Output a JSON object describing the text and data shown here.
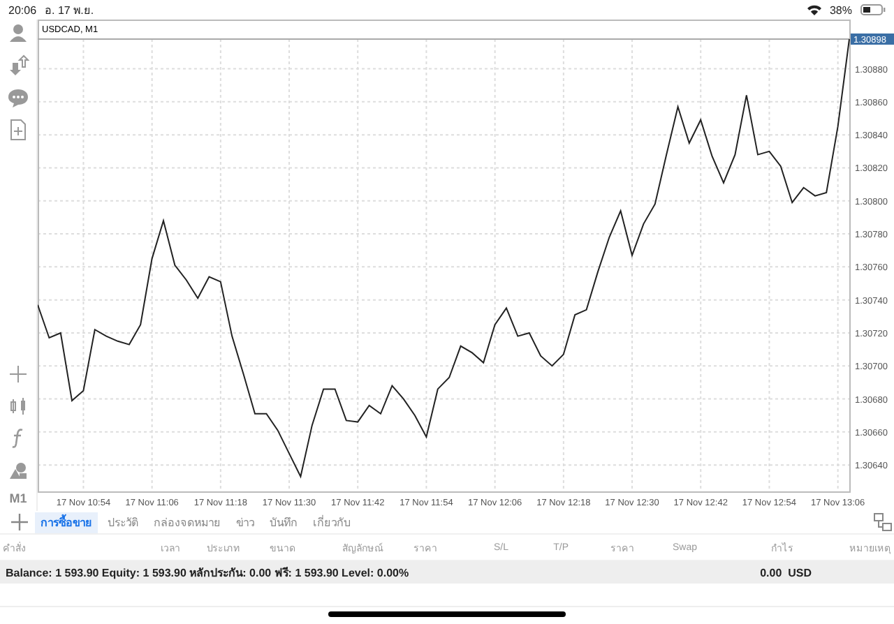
{
  "status_bar": {
    "time": "20:06",
    "date": "อ. 17 พ.ย.",
    "battery": "38%"
  },
  "toolbar": {
    "timeframe": "M1"
  },
  "chart": {
    "title": "USDCAD, M1",
    "current_price": "1.30898",
    "chart_data": {
      "type": "line",
      "grid": true,
      "ylim": [
        1.30624,
        1.30898
      ],
      "categories": [
        null,
        null,
        null,
        null,
        "17 Nov 10:54",
        null,
        null,
        null,
        null,
        null,
        "17 Nov 11:06",
        null,
        null,
        null,
        null,
        null,
        "17 Nov 11:18",
        null,
        null,
        null,
        null,
        null,
        "17 Nov 11:30",
        null,
        null,
        null,
        null,
        null,
        "17 Nov 11:42",
        null,
        null,
        null,
        null,
        null,
        "17 Nov 11:54",
        null,
        null,
        null,
        null,
        null,
        "17 Nov 12:06",
        null,
        null,
        null,
        null,
        null,
        "17 Nov 12:18",
        null,
        null,
        null,
        null,
        null,
        "17 Nov 12:30",
        null,
        null,
        null,
        null,
        null,
        "17 Nov 12:42",
        null,
        null,
        null,
        null,
        null,
        "17 Nov 12:54",
        null,
        null,
        null,
        null,
        null,
        "17 Nov 13:06",
        null
      ],
      "values": [
        1.30737,
        1.30717,
        1.3072,
        1.30679,
        1.30685,
        1.30722,
        1.30718,
        1.30715,
        1.30713,
        1.30725,
        1.30765,
        1.30788,
        1.30761,
        1.30752,
        1.30741,
        1.30754,
        1.30751,
        1.30718,
        1.30695,
        1.30671,
        1.30671,
        1.30661,
        1.30647,
        1.30633,
        1.30664,
        1.30686,
        1.30686,
        1.30667,
        1.30666,
        1.30676,
        1.30671,
        1.30688,
        1.3068,
        1.3067,
        1.30657,
        1.30686,
        1.30693,
        1.30712,
        1.30708,
        1.30702,
        1.30725,
        1.30735,
        1.30718,
        1.3072,
        1.30706,
        1.307,
        1.30707,
        1.30731,
        1.30734,
        1.30757,
        1.30778,
        1.30794,
        1.30767,
        1.30786,
        1.30798,
        1.30828,
        1.30857,
        1.30835,
        1.30849,
        1.30827,
        1.30811,
        1.30828,
        1.30864,
        1.30828,
        1.3083,
        1.30821,
        1.30799,
        1.30808,
        1.30803,
        1.30805,
        1.30845,
        1.30898
      ],
      "yticks": [
        {
          "value": 1.3064,
          "label": "1.30640"
        },
        {
          "value": 1.3066,
          "label": "1.30660"
        },
        {
          "value": 1.3068,
          "label": "1.30680"
        },
        {
          "value": 1.307,
          "label": "1.30700"
        },
        {
          "value": 1.3072,
          "label": "1.30720"
        },
        {
          "value": 1.3074,
          "label": "1.30740"
        },
        {
          "value": 1.3076,
          "label": "1.30760"
        },
        {
          "value": 1.3078,
          "label": "1.30780"
        },
        {
          "value": 1.308,
          "label": "1.30800"
        },
        {
          "value": 1.3082,
          "label": "1.30820"
        },
        {
          "value": 1.3084,
          "label": "1.30840"
        },
        {
          "value": 1.3086,
          "label": "1.30860"
        },
        {
          "value": 1.3088,
          "label": "1.30880"
        }
      ]
    }
  },
  "tabs": [
    {
      "label": "การซื้อขาย",
      "selected": true
    },
    {
      "label": "ประวัติ",
      "selected": false
    },
    {
      "label": "กล่องจดหมาย",
      "selected": false
    },
    {
      "label": "ข่าว",
      "selected": false
    },
    {
      "label": "บันทึก",
      "selected": false
    },
    {
      "label": "เกี่ยวกับ",
      "selected": false
    }
  ],
  "table": {
    "columns": [
      "คำสั่ง",
      "เวลา",
      "ประเภท",
      "ขนาด",
      "สัญลักษณ์",
      "ราคา",
      "S/L",
      "T/P",
      "ราคา",
      "Swap",
      "กำไร",
      "หมายเหตุ"
    ]
  },
  "summary": {
    "text": "Balance: 1 593.90 Equity: 1 593.90 หลักประกัน: 0.00 ฟรี: 1 593.90 Level: 0.00%",
    "profit": "0.00  USD"
  }
}
